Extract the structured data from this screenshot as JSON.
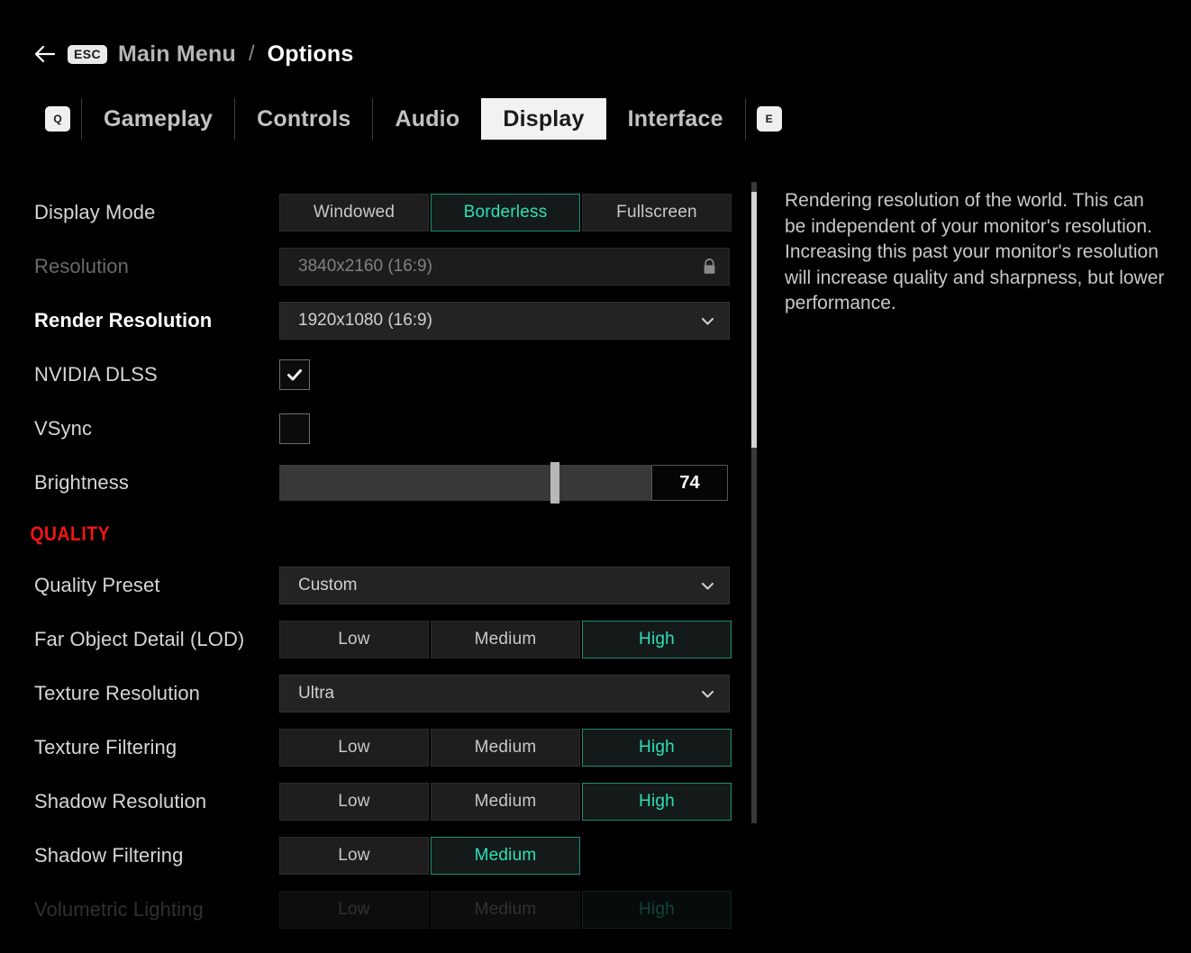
{
  "breadcrumb": {
    "back_icon": "arrow-left-icon",
    "esc_key": "ESC",
    "parent": "Main Menu",
    "separator": "/",
    "current": "Options"
  },
  "tabs": {
    "prev_key": "Q",
    "next_key": "E",
    "items": [
      {
        "label": "Gameplay",
        "active": false
      },
      {
        "label": "Controls",
        "active": false
      },
      {
        "label": "Audio",
        "active": false
      },
      {
        "label": "Display",
        "active": true
      },
      {
        "label": "Interface",
        "active": false
      }
    ]
  },
  "settings": {
    "rows": [
      {
        "name": "display-mode",
        "label": "Display Mode",
        "type": "segmented",
        "options": [
          "Windowed",
          "Borderless",
          "Fullscreen"
        ],
        "value": "Borderless",
        "state": "normal"
      },
      {
        "name": "resolution",
        "label": "Resolution",
        "type": "locked-dropdown",
        "value": "3840x2160 (16:9)",
        "icon": "lock-icon",
        "state": "disabled"
      },
      {
        "name": "render-resolution",
        "label": "Render Resolution",
        "type": "dropdown",
        "value": "1920x1080 (16:9)",
        "icon": "chevron-down-icon",
        "state": "highlighted"
      },
      {
        "name": "nvidia-dlss",
        "label": "NVIDIA DLSS",
        "type": "checkbox",
        "checked": true,
        "state": "normal"
      },
      {
        "name": "vsync",
        "label": "VSync",
        "type": "checkbox",
        "checked": false,
        "state": "normal"
      },
      {
        "name": "brightness",
        "label": "Brightness",
        "type": "slider",
        "value": "74",
        "percent": 74,
        "state": "normal"
      }
    ],
    "section_quality": {
      "title": "QUALITY",
      "color": "#f31414",
      "rows": [
        {
          "name": "quality-preset",
          "label": "Quality Preset",
          "type": "dropdown",
          "value": "Custom",
          "icon": "chevron-down-icon",
          "state": "normal"
        },
        {
          "name": "far-object-detail-lod",
          "label": "Far Object Detail (LOD)",
          "type": "segmented",
          "options": [
            "Low",
            "Medium",
            "High"
          ],
          "value": "High",
          "state": "normal"
        },
        {
          "name": "texture-resolution",
          "label": "Texture Resolution",
          "type": "dropdown",
          "value": "Ultra",
          "icon": "chevron-down-icon",
          "state": "normal"
        },
        {
          "name": "texture-filtering",
          "label": "Texture Filtering",
          "type": "segmented",
          "options": [
            "Low",
            "Medium",
            "High"
          ],
          "value": "High",
          "state": "normal"
        },
        {
          "name": "shadow-resolution",
          "label": "Shadow Resolution",
          "type": "segmented",
          "options": [
            "Low",
            "Medium",
            "High"
          ],
          "value": "High",
          "state": "normal"
        },
        {
          "name": "shadow-filtering",
          "label": "Shadow Filtering",
          "type": "segmented",
          "options": [
            "Low",
            "Medium"
          ],
          "value": "Medium",
          "state": "normal"
        },
        {
          "name": "volumetric-lighting",
          "label": "Volumetric Lighting",
          "type": "segmented",
          "options": [
            "Low",
            "Medium",
            "High"
          ],
          "value": "High",
          "state": "fading"
        }
      ]
    }
  },
  "scrollbar": {
    "thumb_top_percent": 1.5,
    "thumb_height_percent": 40
  },
  "description": {
    "text": "Rendering resolution of the world. This can be independent of your monitor's resolution. Increasing this past your monitor's resolution will increase quality and sharpness, but lower performance."
  },
  "colors": {
    "accent_teal": "#2fe0b8",
    "section_red": "#f31414",
    "active_tab_bg": "#f2f2f2"
  }
}
